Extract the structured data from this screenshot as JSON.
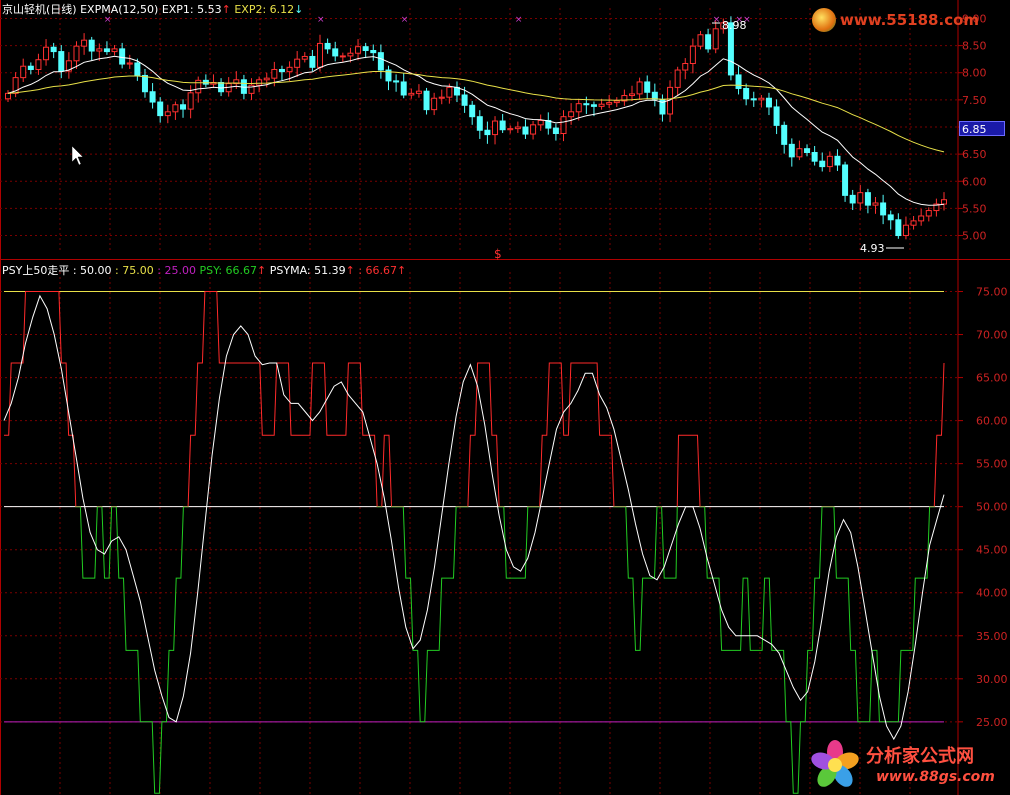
{
  "header_top": {
    "stock_name": "京山轻机(日线)",
    "indicator": "EXPMA(12,50)",
    "exp1_label": "EXP1: 5.53",
    "exp1_arrow": "↑",
    "exp2_label": "EXP2: 6.12",
    "exp2_arrow": "↓"
  },
  "header_bottom": {
    "indicator": "PSY上50走平",
    "v1": ": 50.00",
    "v2": ": 75.00",
    "v3": ": 25.00",
    "psy_label": "PSY: 66.67",
    "psy_arrow": "↑",
    "psyma_label": "PSYMA: 51.39",
    "psyma_arrow": "↑",
    "v4": ": 66.67",
    "v4_arrow": "↑"
  },
  "current_price_tag": "6.85",
  "high_annotation": "8.98",
  "low_annotation": "4.93",
  "mid_marker": "$",
  "top_logo": "www.55188.com",
  "bottom_logo": {
    "title": "分析家公式网",
    "url": "www.88gs.com"
  },
  "colors": {
    "up": "#ff3030",
    "down": "#54ffff",
    "exp1": "#ffffff",
    "exp2": "#e8e048",
    "psy_above": "#ff2a2a",
    "psy_below": "#22cc22",
    "grid": "#7a0000",
    "axis_text": "#cc2222"
  },
  "chart_data": [
    {
      "type": "candlestick",
      "title": "京山轻机(日线) EXPMA(12,50)",
      "yticks": [
        5.0,
        5.5,
        6.0,
        6.5,
        7.0,
        7.5,
        8.0,
        8.5,
        9.0
      ],
      "ylim": [
        4.77,
        9.23
      ],
      "series": [
        {
          "name": "EXP1",
          "close_last": 5.53
        },
        {
          "name": "EXP2",
          "close_last": 6.12
        }
      ],
      "close": [
        7.62,
        7.91,
        8.12,
        8.06,
        8.24,
        8.47,
        8.39,
        8.03,
        8.22,
        8.49,
        8.6,
        8.4,
        8.44,
        8.39,
        8.44,
        8.16,
        8.18,
        7.95,
        7.65,
        7.46,
        7.21,
        7.28,
        7.41,
        7.33,
        7.63,
        7.86,
        7.79,
        7.82,
        7.65,
        7.8,
        7.87,
        7.62,
        7.77,
        7.87,
        7.9,
        8.06,
        8.02,
        8.1,
        8.25,
        8.3,
        8.1,
        8.54,
        8.44,
        8.31,
        8.31,
        8.36,
        8.48,
        8.41,
        8.37,
        8.05,
        7.85,
        7.83,
        7.59,
        7.62,
        7.66,
        7.32,
        7.53,
        7.55,
        7.73,
        7.59,
        7.4,
        7.19,
        6.94,
        6.86,
        7.11,
        6.95,
        6.97,
        7.0,
        6.87,
        7.04,
        7.12,
        6.98,
        6.88,
        7.19,
        7.28,
        7.43,
        7.41,
        7.38,
        7.42,
        7.45,
        7.48,
        7.58,
        7.61,
        7.83,
        7.64,
        7.51,
        7.24,
        7.73,
        8.05,
        8.17,
        8.49,
        8.7,
        8.44,
        8.81,
        8.92,
        7.96,
        7.71,
        7.52,
        7.5,
        7.53,
        7.37,
        7.03,
        6.68,
        6.45,
        6.6,
        6.53,
        6.37,
        6.27,
        6.46,
        6.3,
        5.74,
        5.6,
        5.79,
        5.56,
        5.6,
        5.38,
        5.29,
        5.0,
        5.19,
        5.27,
        5.36,
        5.46,
        5.58,
        5.66
      ],
      "xlabel": "",
      "ylabel": ""
    },
    {
      "type": "line",
      "title": "PSY上50走平",
      "yticks": [
        25.0,
        30.0,
        35.0,
        40.0,
        45.0,
        50.0,
        55.0,
        60.0,
        65.0,
        70.0,
        75.0
      ],
      "ylim": [
        16.5,
        77.5
      ],
      "hlines": [
        {
          "value": 75.0,
          "color": "#e8e048"
        },
        {
          "value": 50.0,
          "color": "#ffffff"
        },
        {
          "value": 25.0,
          "color": "#c020c0"
        }
      ],
      "series": [
        {
          "name": "PSY",
          "last": 66.67,
          "values": [
            58.3,
            66.7,
            66.7,
            75.0,
            75.0,
            75.0,
            75.0,
            75.0,
            66.7,
            58.3,
            50.0,
            41.7,
            41.7,
            50.0,
            41.7,
            50.0,
            41.7,
            33.3,
            33.3,
            25.0,
            25.0,
            16.7,
            25.0,
            33.3,
            41.7,
            50.0,
            58.3,
            66.7,
            75.0,
            75.0,
            66.7,
            66.7,
            66.7,
            66.7,
            66.7,
            66.7,
            58.3,
            58.3,
            66.7,
            66.7,
            58.3,
            58.3,
            58.3,
            66.7,
            66.7,
            58.3,
            58.3,
            58.3,
            66.7,
            66.7,
            58.3,
            58.3,
            50.0,
            58.3,
            50.0,
            50.0,
            41.7,
            33.3,
            25.0,
            33.3,
            33.3,
            41.7,
            41.7,
            50.0,
            50.0,
            58.3,
            66.7,
            66.7,
            58.3,
            50.0,
            41.7,
            41.7,
            41.7,
            50.0,
            50.0,
            58.3,
            66.7,
            66.7,
            58.3,
            66.7,
            66.7,
            66.7,
            66.7,
            58.3,
            58.3,
            50.0,
            50.0,
            41.7,
            33.3,
            41.7,
            41.7,
            50.0,
            41.7,
            41.7,
            58.3,
            58.3,
            58.3,
            50.0,
            41.7,
            41.7,
            33.3,
            33.3,
            33.3,
            41.7,
            33.3,
            33.3,
            41.7,
            33.3,
            33.3,
            25.0,
            16.7,
            25.0,
            33.3,
            41.7,
            50.0,
            50.0,
            41.7,
            41.7,
            33.3,
            25.0,
            25.0,
            33.3,
            25.0,
            25.0,
            25.0,
            33.3,
            33.3,
            41.7,
            41.7,
            50.0,
            58.3,
            66.7
          ]
        },
        {
          "name": "PSYMA",
          "last": 51.39,
          "values": [
            60.0,
            62.0,
            65.0,
            69.0,
            72.0,
            74.5,
            73.0,
            70.0,
            66.0,
            61.0,
            56.0,
            51.0,
            47.0,
            45.0,
            44.5,
            46.0,
            46.5,
            45.0,
            42.0,
            39.0,
            35.0,
            31.0,
            28.0,
            25.5,
            25.0,
            28.0,
            33.0,
            40.0,
            48.0,
            56.0,
            62.5,
            67.5,
            70.0,
            71.0,
            70.0,
            67.5,
            66.5,
            66.7,
            66.7,
            63.0,
            62.0,
            62.0,
            61.0,
            60.0,
            61.0,
            62.5,
            64.0,
            64.5,
            63.0,
            62.0,
            61.0,
            58.0,
            55.0,
            51.0,
            46.0,
            40.5,
            36.0,
            33.5,
            34.5,
            38.0,
            43.0,
            49.0,
            55.0,
            60.5,
            64.5,
            66.5,
            64.0,
            59.5,
            54.0,
            49.0,
            45.0,
            43.0,
            42.5,
            44.0,
            47.0,
            51.0,
            55.0,
            59.0,
            61.0,
            62.0,
            63.5,
            65.5,
            65.5,
            63.0,
            61.5,
            59.0,
            55.5,
            52.0,
            48.0,
            44.5,
            42.0,
            41.5,
            43.0,
            45.5,
            48.0,
            50.0,
            50.0,
            47.5,
            44.0,
            41.0,
            38.0,
            36.0,
            35.0,
            35.0,
            35.0,
            35.0,
            34.5,
            34.0,
            33.0,
            31.0,
            29.0,
            27.5,
            28.5,
            32.0,
            37.0,
            42.5,
            46.5,
            48.5,
            47.0,
            43.0,
            38.0,
            33.0,
            28.0,
            24.5,
            23.0,
            24.5,
            28.5,
            34.0,
            40.0,
            45.5,
            48.5,
            51.4
          ]
        }
      ],
      "xlabel": "",
      "ylabel": ""
    }
  ]
}
